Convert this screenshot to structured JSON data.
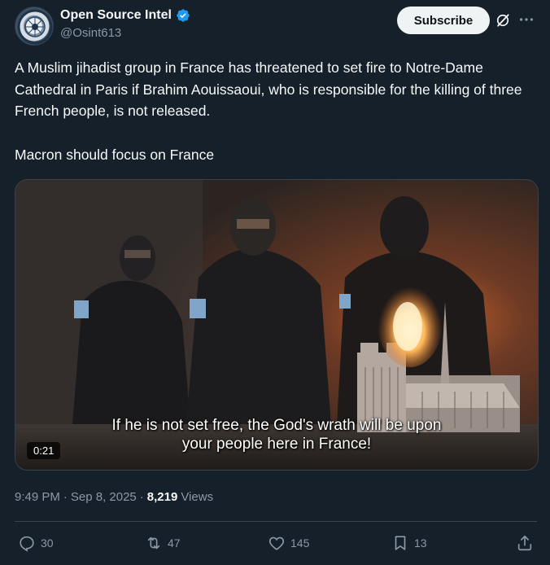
{
  "account": {
    "name": "Open Source Intel",
    "handle": "@Osint613",
    "verified": true
  },
  "header": {
    "subscribe_label": "Subscribe"
  },
  "post": {
    "line1": "A Muslim jihadist group in France has threatened to set fire to Notre-Dame Cathedral in Paris if Brahim Aouissaoui, who is responsible for the killing of three French people, is not released.",
    "line2": "Macron should focus on France"
  },
  "media": {
    "subtitle_line1": "If he is not set free, the God's wrath will be upon",
    "subtitle_line2": "your people here in France!",
    "duration": "0:21"
  },
  "meta": {
    "time": "9:49 PM",
    "separator1": "·",
    "date": "Sep 8, 2025",
    "separator2": "·",
    "views_count": "8,219",
    "views_label": "Views"
  },
  "actions": {
    "replies": "30",
    "reposts": "47",
    "likes": "145",
    "bookmarks": "13"
  },
  "colors": {
    "background": "#15202b",
    "text": "#f7f9f9",
    "muted": "#8b98a5",
    "verified": "#1d9bf0",
    "divider": "#38444d"
  },
  "icons": [
    "verified-badge-icon",
    "grok-icon",
    "more-icon",
    "reply-icon",
    "repost-icon",
    "like-icon",
    "bookmark-icon",
    "share-icon"
  ]
}
